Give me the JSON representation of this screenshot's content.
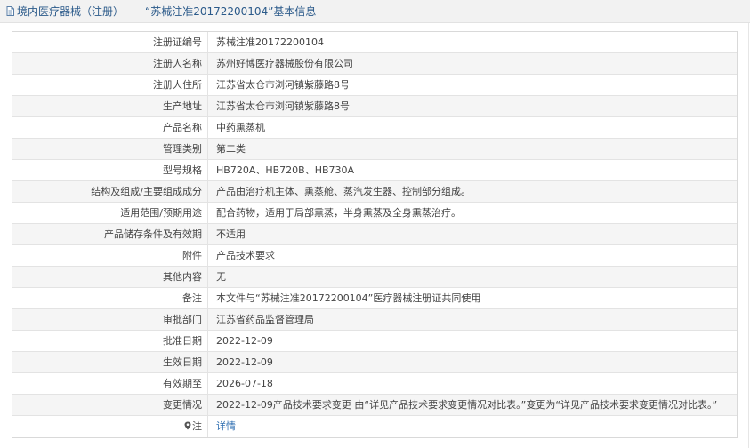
{
  "header": {
    "title": "境内医疗器械（注册）——“苏械注准20172200104”基本信息"
  },
  "rows": [
    {
      "label": "注册证编号",
      "value": "苏械注准20172200104"
    },
    {
      "label": "注册人名称",
      "value": "苏州好博医疗器械股份有限公司"
    },
    {
      "label": "注册人住所",
      "value": "江苏省太仓市浏河镇紫藤路8号"
    },
    {
      "label": "生产地址",
      "value": "江苏省太仓市浏河镇紫藤路8号"
    },
    {
      "label": "产品名称",
      "value": "中药熏蒸机"
    },
    {
      "label": "管理类别",
      "value": "第二类"
    },
    {
      "label": "型号规格",
      "value": "HB720A、HB720B、HB730A"
    },
    {
      "label": "结构及组成/主要组成成分",
      "value": "产品由治疗机主体、熏蒸舱、蒸汽发生器、控制部分组成。"
    },
    {
      "label": "适用范围/预期用途",
      "value": "配合药物，适用于局部熏蒸，半身熏蒸及全身熏蒸治疗。"
    },
    {
      "label": "产品储存条件及有效期",
      "value": "不适用"
    },
    {
      "label": "附件",
      "value": "产品技术要求"
    },
    {
      "label": "其他内容",
      "value": "无"
    },
    {
      "label": "备注",
      "value": "本文件与“苏械注准20172200104”医疗器械注册证共同使用"
    },
    {
      "label": "审批部门",
      "value": "江苏省药品监督管理局"
    },
    {
      "label": "批准日期",
      "value": "2022-12-09"
    },
    {
      "label": "生效日期",
      "value": "2022-12-09"
    },
    {
      "label": "有效期至",
      "value": "2026-07-18"
    },
    {
      "label": "变更情况",
      "value": "2022-12-09产品技术要求变更 由“详见产品技术要求变更情况对比表。”变更为“详见产品技术要求变更情况对比表。”"
    }
  ],
  "note_row": {
    "label": "注",
    "link_text": "详情"
  },
  "colors": {
    "title": "#2b5a8a",
    "link": "#2b6cb0",
    "header_bg": "#f2f2f2",
    "stripe_bg": "#f5f5f5"
  }
}
